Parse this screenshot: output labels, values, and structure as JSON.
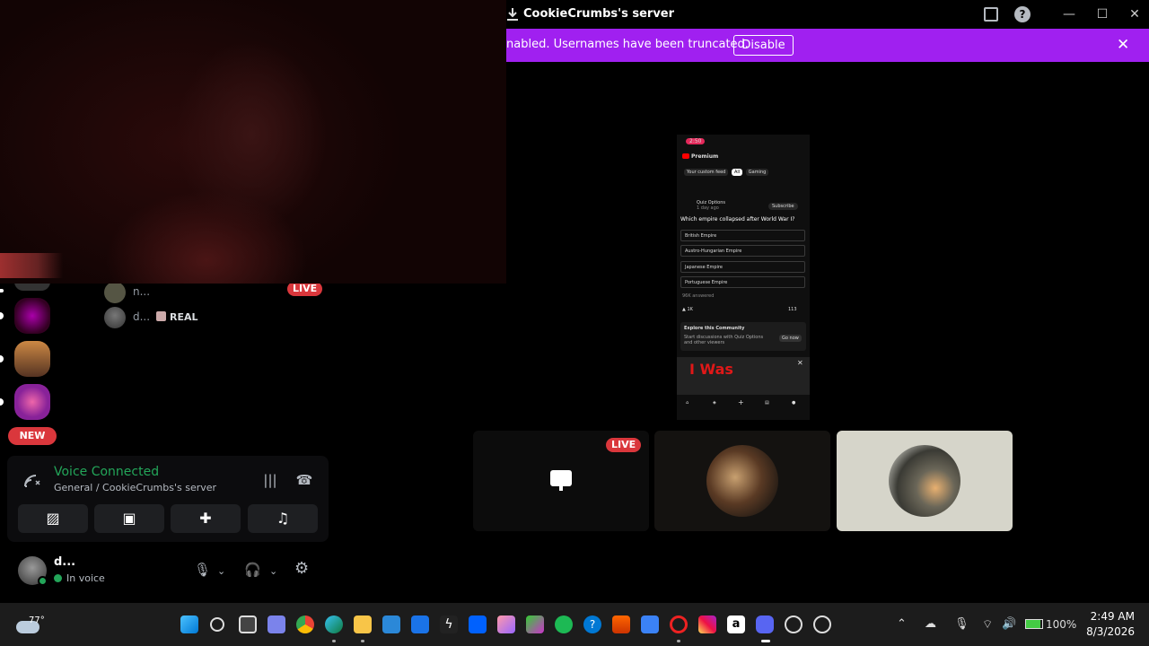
{
  "window": {
    "title": "CookieCrumbs's server"
  },
  "notice": {
    "text": "nabled. Usernames have been truncated.",
    "disable_label": "Disable",
    "close_glyph": "✕"
  },
  "sidebar": {
    "new_badge": "NEW",
    "users": [
      {
        "name": "n...",
        "live": "LIVE"
      },
      {
        "name": "d...",
        "badge": "REAL"
      }
    ]
  },
  "voice": {
    "status": "Voice Connected",
    "channel": "General / CookieCrumbs's server"
  },
  "user": {
    "name": "d...",
    "status": "In voice"
  },
  "stream": {
    "clock": "2:50",
    "premium": "Premium",
    "chips": [
      "Your custom feed",
      "All",
      "Gaming"
    ],
    "channel_name": "Quiz Options",
    "channel_time": "1 day ago",
    "subscribe": "Subscribe",
    "question": "Which empire collapsed after World War I?",
    "options": [
      "British Empire",
      "Austro-Hungarian Empire",
      "Japanese Empire",
      "Portuguese Empire"
    ],
    "answered": "96K answered",
    "likes": "1K",
    "comments": "113",
    "explore_title": "Explore this Community",
    "explore_text": "Start discussions with Quiz Options and other viewers",
    "explore_btn": "Go now",
    "mini_text": "I Was"
  },
  "tiles": {
    "live": "LIVE"
  },
  "taskbar": {
    "temperature": "77°",
    "battery": "100%",
    "time": "2:49 AM",
    "date": "8/3/2026"
  },
  "colors": {
    "accent_purple": "#a020f0",
    "live_red": "#da373c",
    "voice_green": "#23a559"
  }
}
